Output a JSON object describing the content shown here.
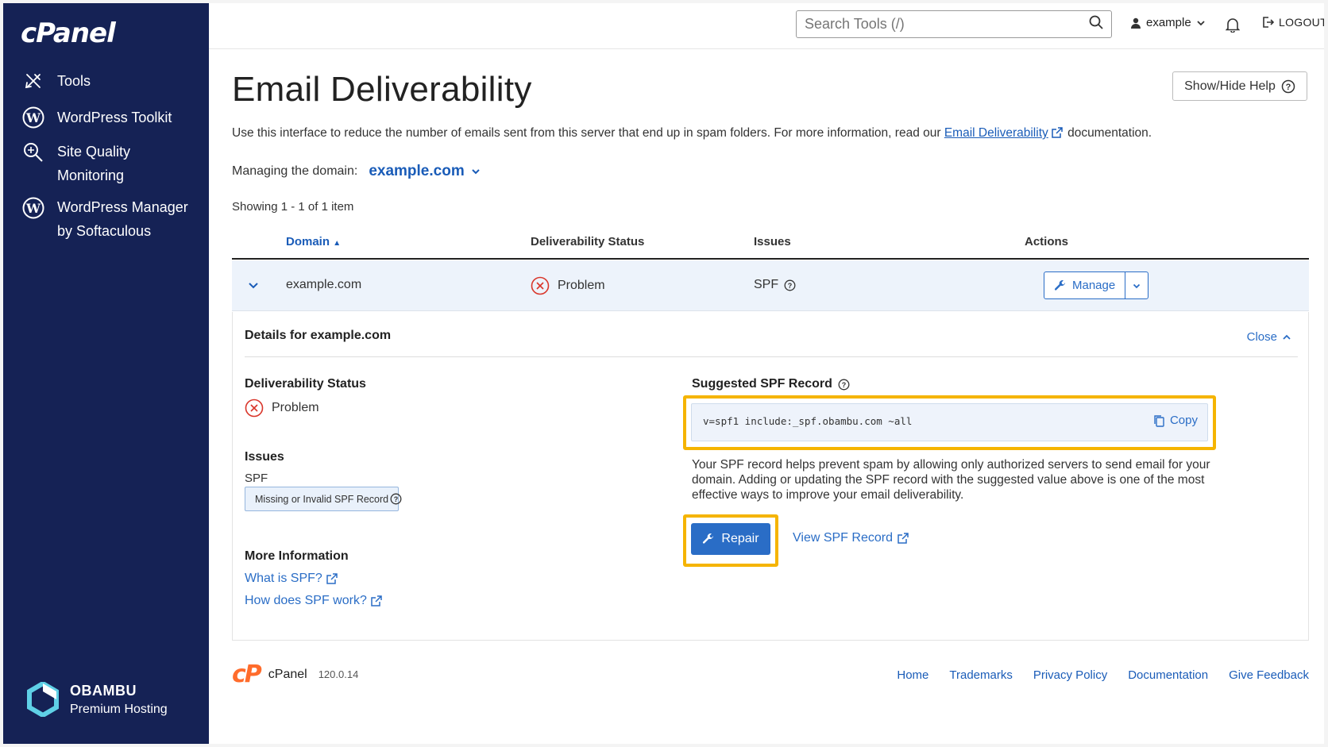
{
  "sidebar": {
    "logo": "cPanel",
    "items": [
      {
        "label": "Tools",
        "icon": "tools-icon"
      },
      {
        "label": "WordPress Toolkit",
        "icon": "wordpress-icon"
      },
      {
        "label": "Site Quality Monitoring",
        "icon": "magnifier-icon"
      },
      {
        "label": "WordPress Manager by Softaculous",
        "icon": "wordpress-icon"
      }
    ],
    "brand": {
      "name": "OBAMBU",
      "subtitle": "Premium Hosting"
    }
  },
  "topbar": {
    "search_placeholder": "Search Tools (/)",
    "user": "example",
    "logout": "LOGOUT"
  },
  "page": {
    "title": "Email Deliverability",
    "help_button": "Show/Hide Help",
    "intro_before": "Use this interface to reduce the number of emails sent from this server that end up in spam folders. For more information, read our ",
    "intro_link": "Email Deliverability",
    "intro_after": " documentation.",
    "managing_label": "Managing the domain:",
    "managing_domain": "example.com",
    "showing": "Showing 1 - 1 of 1 item"
  },
  "table": {
    "columns": [
      "Domain",
      "Deliverability Status",
      "Issues",
      "Actions"
    ],
    "row": {
      "domain": "example.com",
      "status": "Problem",
      "issues": "SPF",
      "action": "Manage"
    }
  },
  "details": {
    "title": "Details for example.com",
    "close": "Close",
    "status_heading": "Deliverability Status",
    "status": "Problem",
    "issues_heading": "Issues",
    "issue_type": "SPF",
    "issue_badge": "Missing or Invalid SPF Record",
    "more_info_heading": "More Information",
    "links": [
      "What is SPF?",
      "How does SPF work?"
    ],
    "suggested_heading": "Suggested SPF Record",
    "spf_record": "v=spf1 include:_spf.obambu.com ~all",
    "copy": "Copy",
    "description": "Your SPF record helps prevent spam by allowing only authorized servers to send email for your domain. Adding or updating the SPF record with the suggested value above is one of the most effective ways to improve your email deliverability.",
    "repair": "Repair",
    "view_spf": "View SPF Record"
  },
  "footer": {
    "brand": "cPanel",
    "version": "120.0.14",
    "links": [
      "Home",
      "Trademarks",
      "Privacy Policy",
      "Documentation",
      "Give Feedback"
    ]
  },
  "colors": {
    "sidebar_bg": "#152255",
    "link": "#2a6dc6",
    "highlight": "#f5b400",
    "problem": "#d9362b",
    "cpanel_orange": "#ff6c2c"
  }
}
